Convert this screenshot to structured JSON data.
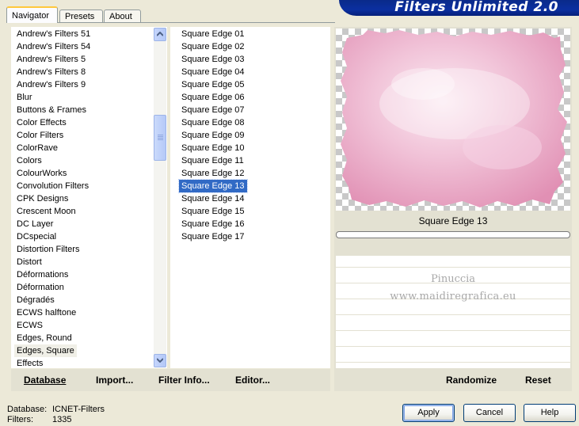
{
  "tabs": {
    "navigator": "Navigator",
    "presets": "Presets",
    "about": "About"
  },
  "banner": {
    "title": "Filters Unlimited 2.0"
  },
  "categories": [
    "Andrew's Filters 51",
    "Andrew's Filters 54",
    "Andrew's Filters 5",
    "Andrew's Filters 8",
    "Andrew's Filters 9",
    "Blur",
    "Buttons & Frames",
    "Color Effects",
    "Color Filters",
    "ColorRave",
    "Colors",
    "ColourWorks",
    "Convolution Filters",
    "CPK Designs",
    "Crescent Moon",
    "DC Layer",
    "DCspecial",
    "Distortion Filters",
    "Distort",
    "Déformations",
    "Déformation",
    "Dégradés",
    "ECWS halftone",
    "ECWS",
    "Edges, Round",
    "Edges, Square",
    "Effects"
  ],
  "selected_category": "Edges, Square",
  "filters": [
    "Square Edge 01",
    "Square Edge 02",
    "Square Edge 03",
    "Square Edge 04",
    "Square Edge 05",
    "Square Edge 06",
    "Square Edge 07",
    "Square Edge 08",
    "Square Edge 09",
    "Square Edge 10",
    "Square Edge 11",
    "Square Edge 12",
    "Square Edge 13",
    "Square Edge 14",
    "Square Edge 15",
    "Square Edge 16",
    "Square Edge 17"
  ],
  "selected_filter": "Square Edge 13",
  "toolbar": {
    "database": "Database",
    "import": "Import...",
    "filter_info": "Filter Info...",
    "editor": "Editor..."
  },
  "preview": {
    "caption": "Square Edge 13",
    "watermark_name": "Pinuccia",
    "watermark_url": "www.maidiregrafica.eu"
  },
  "right_buttons": {
    "randomize": "Randomize",
    "reset": "Reset"
  },
  "status": {
    "database_label": "Database:",
    "database_value": "ICNET-Filters",
    "filters_label": "Filters:",
    "filters_value": "1335"
  },
  "dialog_buttons": {
    "apply": "Apply",
    "cancel": "Cancel",
    "help": "Help"
  },
  "colors": {
    "selection": "#316ac5",
    "banner": "#0b2fa0",
    "panel": "#ece9d8"
  },
  "icons": {
    "scroll_up": "chevron-up-icon",
    "scroll_down": "chevron-down-icon"
  }
}
